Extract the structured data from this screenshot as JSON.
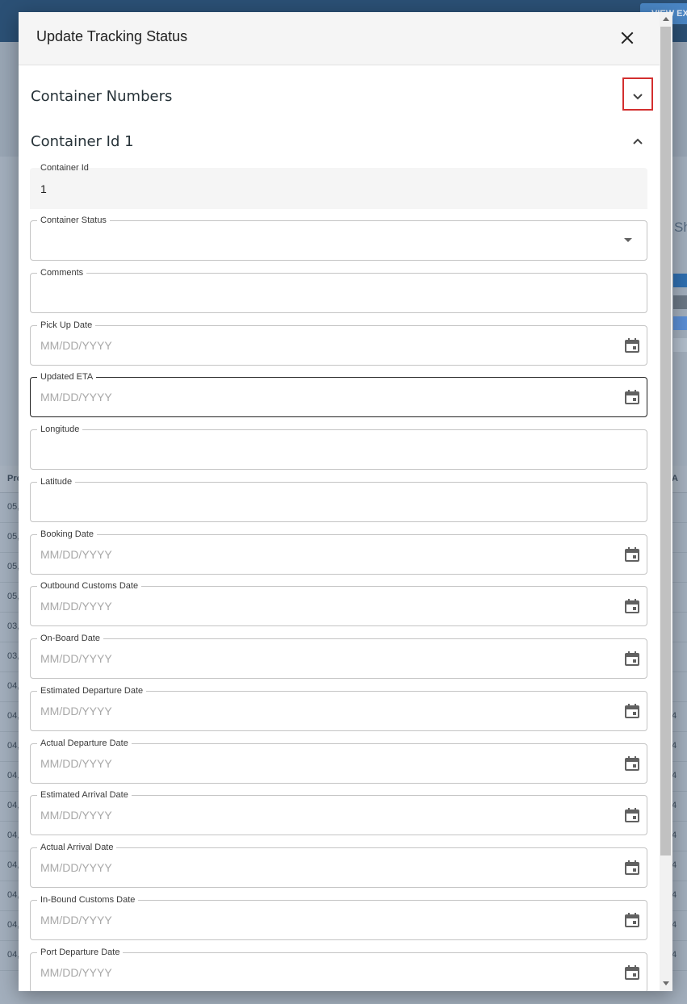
{
  "background": {
    "top_button": "VIEW EX",
    "side_text": "Sh",
    "table_header_left": "Pro",
    "table_header_right": "A",
    "rows_left": [
      "05,",
      "05,",
      "05,",
      "05,",
      "03,",
      "03,",
      "04,",
      "04,",
      "04,",
      "04,",
      "04,",
      "04,",
      "04,",
      "04,",
      "04,",
      "04,"
    ],
    "rows_right": [
      "",
      "",
      "",
      "",
      "",
      "",
      "",
      "4",
      "4",
      "4",
      "4",
      "4",
      "4",
      "4",
      "4",
      "4"
    ]
  },
  "dialog": {
    "title": "Update Tracking Status",
    "close_icon": "close-icon"
  },
  "sections": {
    "container_numbers": "Container Numbers",
    "container_id_1": "Container Id 1"
  },
  "container_id_field": {
    "label": "Container Id",
    "value": "1"
  },
  "container_status": {
    "label": "Container Status",
    "value": ""
  },
  "comments": {
    "label": "Comments",
    "value": ""
  },
  "date_placeholder": "MM/DD/YYYY",
  "fields": {
    "pick_up_date": "Pick Up Date",
    "updated_eta": "Updated ETA",
    "longitude": "Longitude",
    "latitude": "Latitude",
    "booking_date": "Booking Date",
    "outbound_customs_date": "Outbound Customs Date",
    "on_board_date": "On-Board Date",
    "estimated_departure_date": "Estimated Departure Date",
    "actual_departure_date": "Actual Departure Date",
    "estimated_arrival_date": "Estimated Arrival Date",
    "actual_arrival_date": "Actual Arrival Date",
    "in_bound_customs_date": "In-Bound Customs Date",
    "port_departure_date": "Port Departure Date"
  },
  "colors": {
    "highlight": "#d32f2f",
    "focused_border": "#212121",
    "field_border": "#c4c4c4"
  }
}
